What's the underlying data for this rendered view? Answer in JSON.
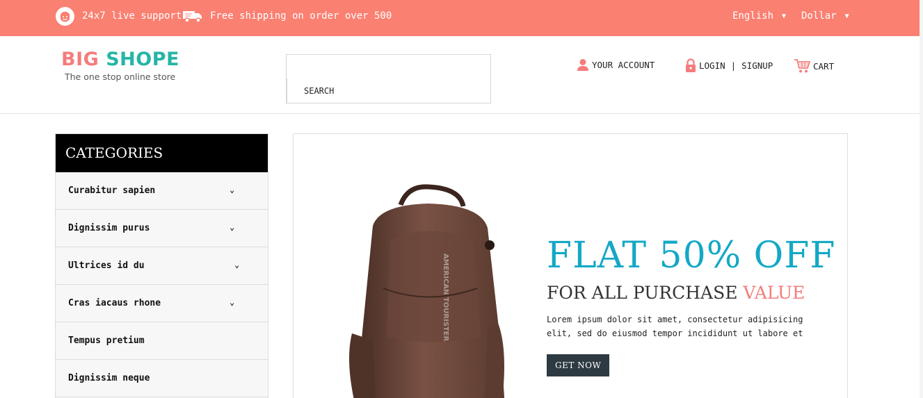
{
  "topbar": {
    "support_text": "24x7 live support",
    "shipping_text": "Free shipping on order over 500",
    "language": "English",
    "currency": "Dollar",
    "background_color": "#fa8072"
  },
  "header": {
    "logo_part1": "BIG",
    "logo_part2": "SHOPE",
    "tagline": "The one stop online store",
    "search_placeholder": "",
    "search_button": "SEARCH",
    "account_label": "YOUR ACCOUNT",
    "login_label": "LOGIN",
    "signup_label": "SIGNUP",
    "separator": "|",
    "cart_label": "CART"
  },
  "categories": {
    "title": "CATEGORIES",
    "items": [
      {
        "label": "Curabitur sapien",
        "has_submenu": true
      },
      {
        "label": "Dignissim purus",
        "has_submenu": true
      },
      {
        "label": "Ultrices id du",
        "has_submenu": true
      },
      {
        "label": "Cras iacaus rhone",
        "has_submenu": true
      },
      {
        "label": "Tempus pretium",
        "has_submenu": false
      },
      {
        "label": "Dignissim neque",
        "has_submenu": false
      }
    ]
  },
  "banner": {
    "headline": "FLAT 50% OFF",
    "subline_main": "FOR ALL PURCHASE",
    "subline_highlight": "VALUE",
    "description": "Lorem ipsum dolor sit amet, consectetur adipisicing elit, sed do eiusmod tempor incididunt ut labore et",
    "button_label": "GET NOW",
    "product_brand": "AMERICAN TOURISTER",
    "accent_color": "#14a8c6",
    "highlight_color": "#f47c7c"
  }
}
